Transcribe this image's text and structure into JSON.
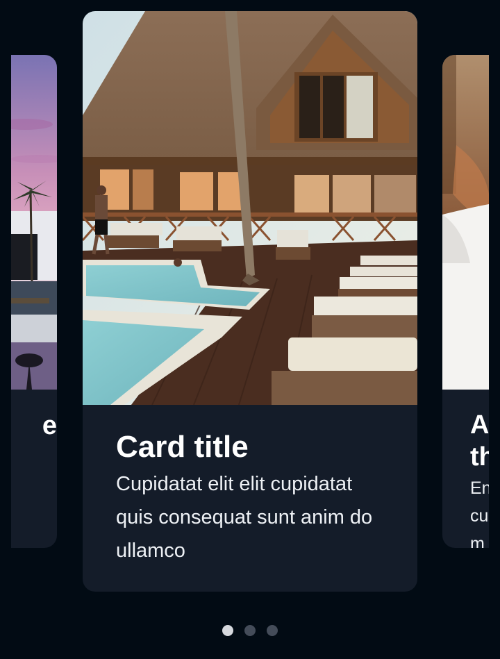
{
  "carousel": {
    "cards": [
      {
        "title_fragment": "e"
      },
      {
        "title": "Card title",
        "description": "Cupidatat elit elit cupidatat quis consequat sunt anim do ullamco"
      },
      {
        "title_fragment_line1": "A",
        "title_fragment_line2": "th",
        "desc_line1": "En",
        "desc_line2": "cu",
        "desc_line3": "m"
      }
    ],
    "pagination": {
      "count": 3,
      "active_index": 0
    }
  },
  "colors": {
    "background": "#020b14",
    "card": "#141c29",
    "dot_active": "#d6d9de",
    "dot_inactive": "#444c59"
  }
}
